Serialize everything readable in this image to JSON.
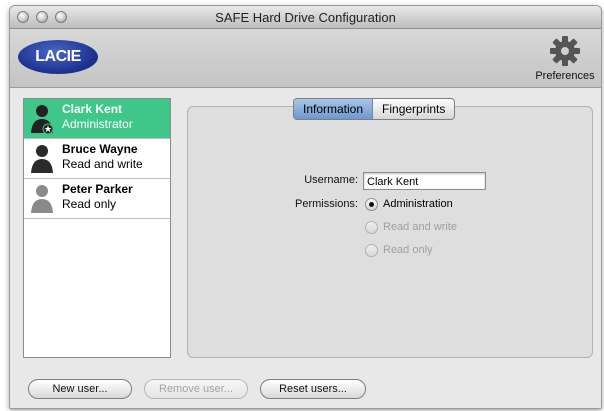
{
  "window": {
    "title": "SAFE Hard Drive Configuration"
  },
  "toolbar": {
    "logo_text": "LACIE",
    "preferences_label": "Preferences",
    "preferences_icon": "gear-icon"
  },
  "users": [
    {
      "name": "Clark Kent",
      "role": "Administrator",
      "selected": true
    },
    {
      "name": "Bruce Wayne",
      "role": "Read and write",
      "selected": false
    },
    {
      "name": "Peter Parker",
      "role": "Read only",
      "selected": false
    }
  ],
  "tabs": [
    {
      "label": "Information",
      "selected": true
    },
    {
      "label": "Fingerprints",
      "selected": false
    }
  ],
  "form": {
    "username_label": "Username:",
    "username_value": "Clark Kent",
    "permissions_label": "Permissions:",
    "options": [
      {
        "label": "Administration",
        "selected": true,
        "enabled": true
      },
      {
        "label": "Read and write",
        "selected": false,
        "enabled": false
      },
      {
        "label": "Read only",
        "selected": false,
        "enabled": false
      }
    ]
  },
  "buttons": {
    "new_user": "New user...",
    "remove_user": "Remove user...",
    "reset_users": "Reset users..."
  },
  "colors": {
    "selection": "#3fc78a",
    "logo": "#1b2f8c"
  }
}
